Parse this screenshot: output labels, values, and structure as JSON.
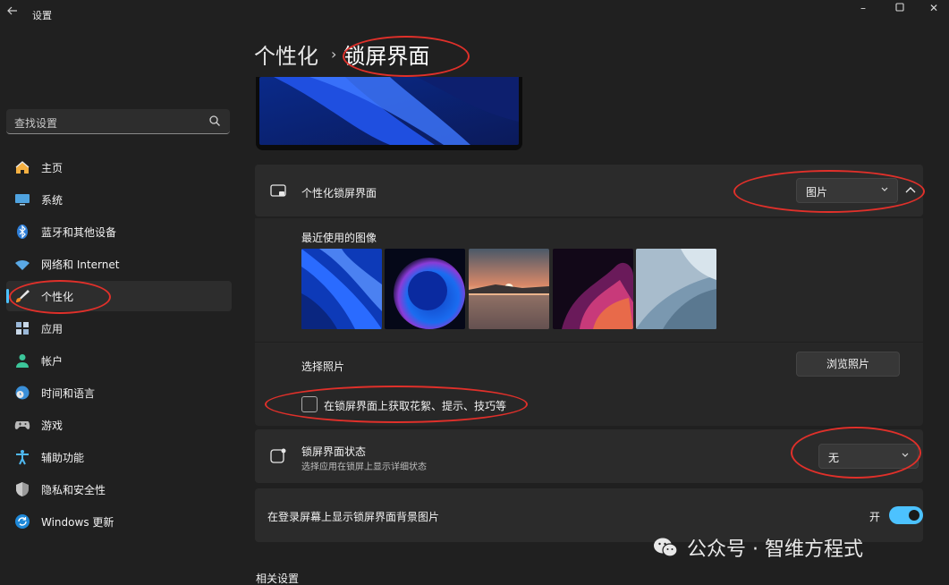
{
  "window": {
    "title": "设置",
    "back_icon": "arrow-left-icon"
  },
  "sidebar": {
    "search": {
      "placeholder": "查找设置",
      "icon": "search-icon"
    },
    "items": [
      {
        "label": "主页",
        "icon": "home-icon",
        "active": false
      },
      {
        "label": "系统",
        "icon": "monitor-icon",
        "active": false
      },
      {
        "label": "蓝牙和其他设备",
        "icon": "bluetooth-icon",
        "active": false
      },
      {
        "label": "网络和 Internet",
        "icon": "wifi-icon",
        "active": false
      },
      {
        "label": "个性化",
        "icon": "brush-icon",
        "active": true
      },
      {
        "label": "应用",
        "icon": "apps-icon",
        "active": false
      },
      {
        "label": "帐户",
        "icon": "person-icon",
        "active": false
      },
      {
        "label": "时间和语言",
        "icon": "clock-globe-icon",
        "active": false
      },
      {
        "label": "游戏",
        "icon": "gamepad-icon",
        "active": false
      },
      {
        "label": "辅助功能",
        "icon": "accessibility-icon",
        "active": false
      },
      {
        "label": "隐私和安全性",
        "icon": "shield-icon",
        "active": false
      },
      {
        "label": "Windows 更新",
        "icon": "update-icon",
        "active": false
      }
    ]
  },
  "breadcrumb": {
    "parent": "个性化",
    "separator": "›",
    "current": "锁屏界面"
  },
  "lock_screen": {
    "personalize": {
      "title": "个性化锁屏界面",
      "icon": "lockscreen-icon",
      "dropdown_value": "图片",
      "expanded": true
    },
    "recent_images_label": "最近使用的图像",
    "recent_images": [
      "bloom-blue-wallpaper",
      "blue-orb-wallpaper",
      "sunset-lake-wallpaper",
      "purple-swirl-wallpaper",
      "light-bloom-wallpaper"
    ],
    "choose_photo": {
      "label": "选择照片",
      "button": "浏览照片"
    },
    "tips_checkbox": {
      "label": "在锁屏界面上获取花絮、提示、技巧等",
      "checked": false
    },
    "status": {
      "title": "锁屏界面状态",
      "subtitle": "选择应用在锁屏上显示详细状态",
      "icon": "status-icon",
      "dropdown_value": "无"
    },
    "signin_background": {
      "label": "在登录屏幕上显示锁屏界面背景图片",
      "toggle_label": "开",
      "on": true
    }
  },
  "related_settings": "相关设置",
  "watermark": {
    "text": "公众号 · 智维方程式",
    "icon": "wechat-icon"
  },
  "colors": {
    "accent": "#4cc2ff",
    "annotation": "#e0302a",
    "background": "#202020",
    "card": "#2b2b2b"
  }
}
